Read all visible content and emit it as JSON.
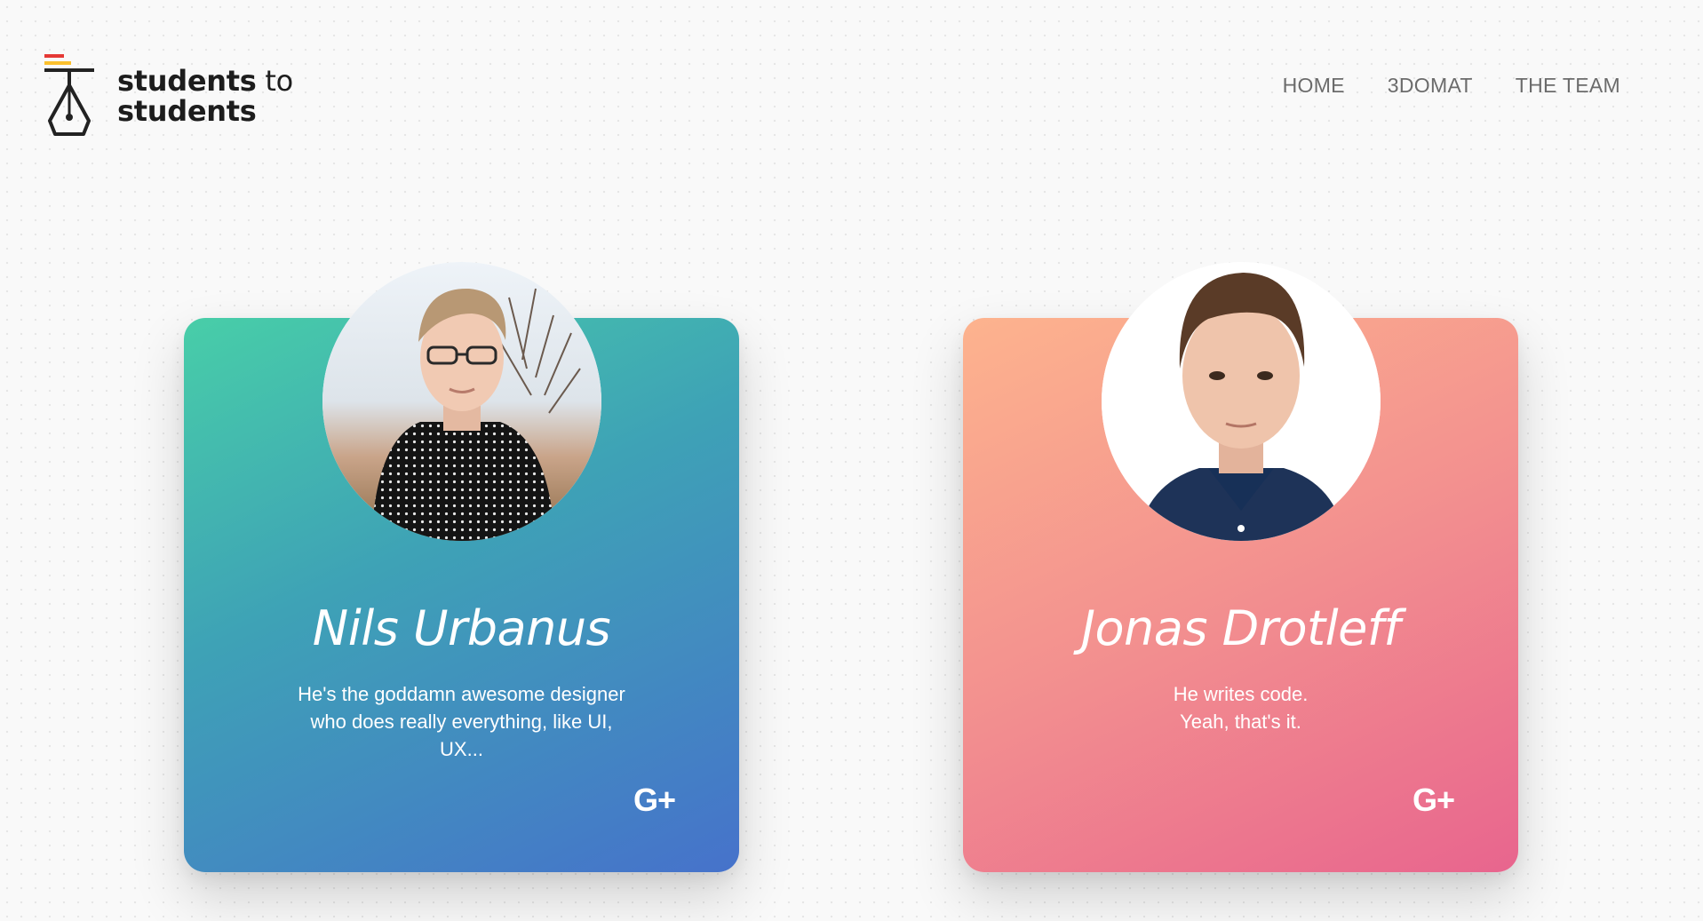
{
  "brand": {
    "line1_bold": "students",
    "line1_light": " to",
    "line2_bold": "students",
    "logo_icon": "fountain-pen-nib-icon",
    "logo_accent_colors": [
      "#e53935",
      "#fbc02d",
      "#222222"
    ]
  },
  "nav": {
    "items": [
      {
        "label": "HOME"
      },
      {
        "label": "3DOMAT"
      },
      {
        "label": "THE TEAM"
      }
    ]
  },
  "team": [
    {
      "name": "Nils Urbanus",
      "bio": "He's the goddamn awesome designer\nwho does really everything, like UI,\nUX...",
      "social_icon": "google-plus-icon",
      "social_label": "G+",
      "card_gradient": [
        "#48cea8",
        "#3ea2b6",
        "#4672cb"
      ]
    },
    {
      "name": "Jonas Drotleff",
      "bio": "He writes code.\nYeah, that's it.",
      "social_icon": "google-plus-icon",
      "social_label": "G+",
      "card_gradient": [
        "#fdb38e",
        "#f3918f",
        "#e8658e"
      ]
    }
  ]
}
